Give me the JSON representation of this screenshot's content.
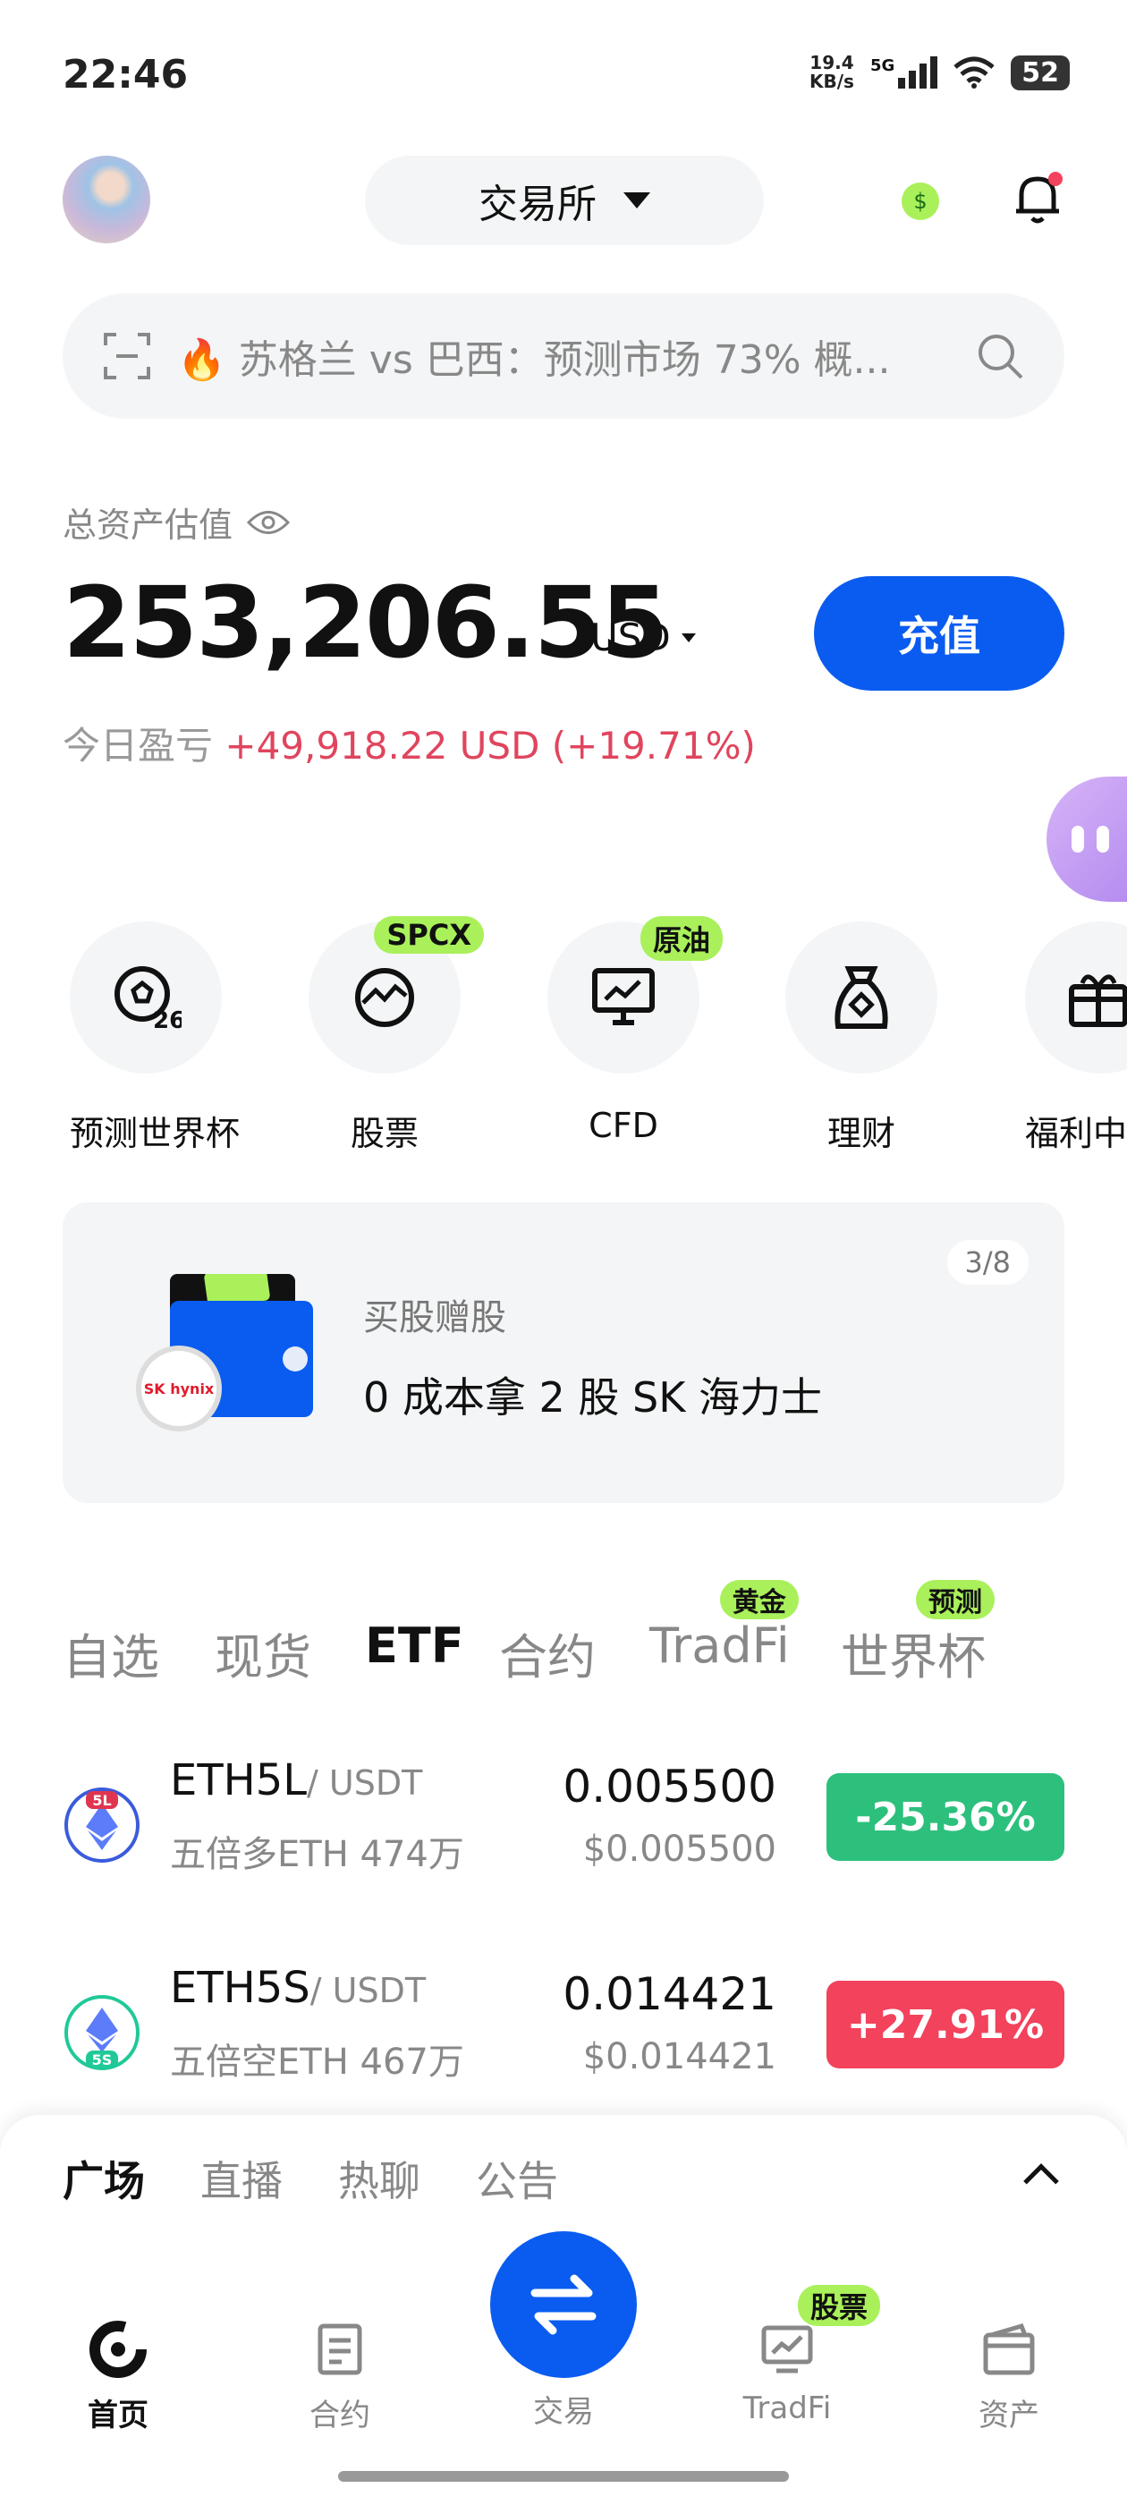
{
  "status_bar": {
    "time": "22:46",
    "net_speed_value": "19.4",
    "net_speed_unit": "KB/s",
    "network": "5G",
    "battery": "52"
  },
  "header": {
    "exchange_label": "交易所"
  },
  "search": {
    "text": "苏格兰 vs 巴西：预测市场 73% 概..."
  },
  "assets": {
    "label": "总资产估值",
    "value": "253,206.55",
    "currency": "USD",
    "deposit_label": "充值",
    "pnl_label": "今日盈亏",
    "pnl_value": "+49,918.22 USD (+19.71%)"
  },
  "quick_actions": [
    {
      "label": "预测世界杯",
      "icon": "soccer-ball-26-icon",
      "badge": ""
    },
    {
      "label": "股票",
      "icon": "globe-chart-icon",
      "badge": "SPCX"
    },
    {
      "label": "CFD",
      "icon": "monitor-chart-icon",
      "badge": "原油"
    },
    {
      "label": "理财",
      "icon": "money-bag-icon",
      "badge": ""
    },
    {
      "label": "福利中",
      "icon": "gift-icon",
      "badge": ""
    }
  ],
  "promo": {
    "counter": "3/8",
    "subtitle": "买股赠股",
    "title": "0 成本拿 2 股 SK 海力士",
    "logo_text": "SK hynix"
  },
  "market_tabs": [
    {
      "label": "自选",
      "badge": ""
    },
    {
      "label": "现货",
      "badge": ""
    },
    {
      "label": "ETF",
      "badge": ""
    },
    {
      "label": "合约",
      "badge": ""
    },
    {
      "label": "TradFi",
      "badge": "黄金"
    },
    {
      "label": "世界杯",
      "badge": "预测"
    }
  ],
  "market_rows": [
    {
      "base": "ETH5L",
      "quote": "/ USDT",
      "subname": "五倍多ETH 474万",
      "price": "0.005500",
      "price_usd": "$0.005500",
      "change": "-25.36%",
      "icon_tag": "5L",
      "color": "#2cc07c"
    },
    {
      "base": "ETH5S",
      "quote": "/ USDT",
      "subname": "五倍空ETH 467万",
      "price": "0.014421",
      "price_usd": "$0.014421",
      "change": "+27.91%",
      "icon_tag": "5S",
      "color": "#f2425c"
    }
  ],
  "sheet_tabs": [
    "广场",
    "直播",
    "热聊",
    "公告"
  ],
  "bottom_nav": {
    "home": "首页",
    "contract": "合约",
    "trade": "交易",
    "tradfi": "TradFi",
    "tradfi_badge": "股票",
    "assets": "资产"
  },
  "colors": {
    "accent_blue": "#0a5cf0",
    "up_green": "#2cc07c",
    "down_red": "#f2425c",
    "badge_lime": "#a9f05a"
  }
}
